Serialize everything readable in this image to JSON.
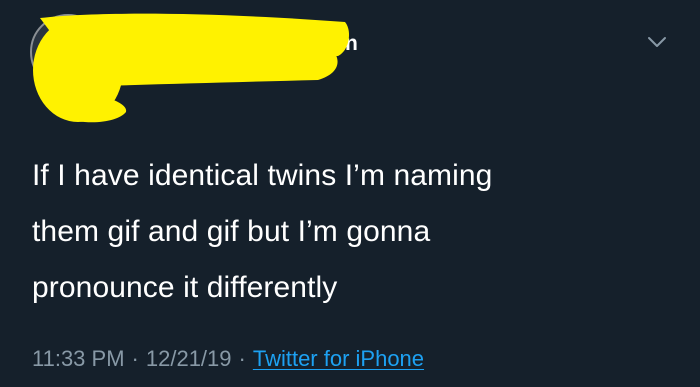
{
  "header": {
    "name_fragment": "n"
  },
  "tweet": {
    "lines": [
      "If I have identical twins I’m naming",
      "them gif and gif but I’m gonna",
      "pronounce it differently"
    ]
  },
  "meta": {
    "time": "11:33 PM",
    "separator": "·",
    "date": "12/21/19",
    "source": "Twitter for iPhone"
  },
  "icons": {
    "caret": "chevron-down-icon"
  },
  "colors": {
    "background": "#15202b",
    "text": "#ffffff",
    "secondary_text": "#8899a6",
    "link": "#1da1f2",
    "redaction": "#fff200"
  }
}
